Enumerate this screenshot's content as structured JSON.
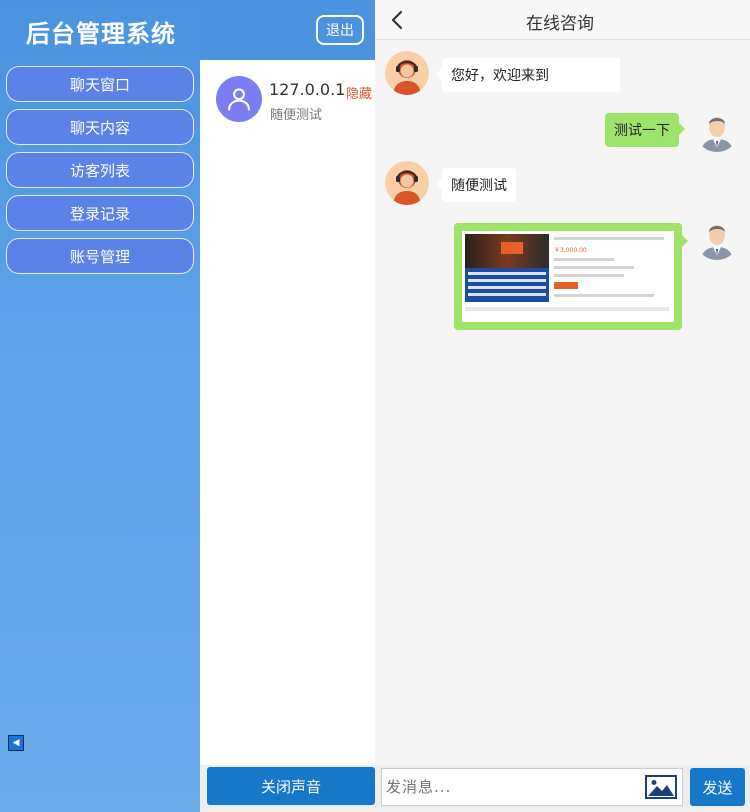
{
  "app": {
    "title": "后台管理系统",
    "logout_label": "退出"
  },
  "sidebar": {
    "items": [
      {
        "label": "聊天窗口"
      },
      {
        "label": "聊天内容"
      },
      {
        "label": "访客列表"
      },
      {
        "label": "登录记录"
      },
      {
        "label": "账号管理"
      }
    ]
  },
  "sessions": [
    {
      "ip": "127.0.0.1",
      "hide_label": "隐藏",
      "preview": "随便测试"
    }
  ],
  "footer": {
    "mute_label": "关闭声音"
  },
  "chat": {
    "title": "在线咨询",
    "messages": [
      {
        "side": "left",
        "text": "您好，欢迎来到"
      },
      {
        "side": "right",
        "text": "测试一下"
      },
      {
        "side": "left",
        "text": "随便测试"
      },
      {
        "side": "right",
        "type": "image",
        "price": "￥3,000.00"
      }
    ],
    "input": {
      "placeholder": "发消息..."
    },
    "send_label": "发送"
  },
  "colors": {
    "sidebar": "#5ea3e8",
    "nav_item": "#5b82e8",
    "primary_button": "#1678c8",
    "bubble_self": "#9ee46b",
    "avatar_placeholder": "#7b7ef2"
  },
  "icons": [
    "back-icon",
    "user-icon",
    "collapse-icon",
    "image-upload-icon"
  ]
}
